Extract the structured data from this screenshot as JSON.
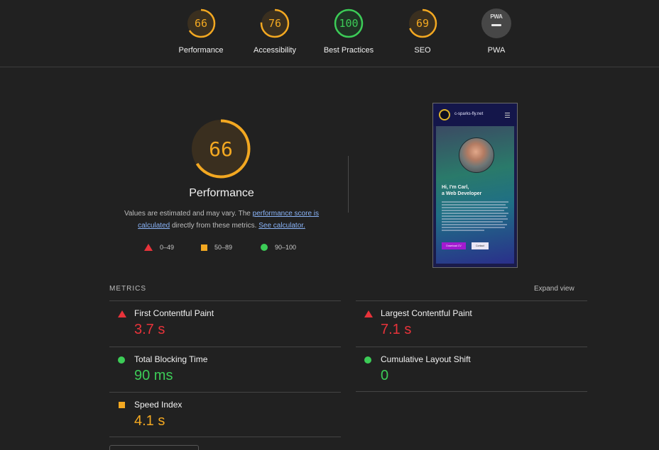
{
  "top_scores": [
    {
      "score": "66",
      "label": "Performance",
      "fraction": 0.66,
      "color": "#f3a821"
    },
    {
      "score": "76",
      "label": "Accessibility",
      "fraction": 0.76,
      "color": "#f3a821"
    },
    {
      "score": "100",
      "label": "Best Practices",
      "fraction": 1.0,
      "color": "#3ccc57"
    },
    {
      "score": "69",
      "label": "SEO",
      "fraction": 0.69,
      "color": "#f3a821"
    },
    {
      "score": "",
      "label": "PWA",
      "badge": "PWA"
    }
  ],
  "main": {
    "score": "66",
    "fraction": 0.66,
    "color": "#f3a821",
    "title": "Performance",
    "desc_1": "Values are estimated and may vary. The ",
    "link_score": "performance score is calculated",
    "desc_2": " directly from these metrics. ",
    "link_calc": "See calculator.",
    "legend": [
      {
        "range": "0–49",
        "symbol": "triangle",
        "color": "#e8333a"
      },
      {
        "range": "50–89",
        "symbol": "square",
        "color": "#f3a821"
      },
      {
        "range": "90–100",
        "symbol": "circle",
        "color": "#3ccc57"
      }
    ]
  },
  "preview": {
    "site_name": "c-sparks-fly.net",
    "heading_line1": "Hi, I'm Carl,",
    "heading_line2": "a Web Developer",
    "button_primary": "Download CV",
    "button_secondary": "Contact"
  },
  "metrics": {
    "heading": "METRICS",
    "expand_label": "Expand view",
    "items": [
      {
        "name": "First Contentful Paint",
        "value": "3.7 s",
        "status": "bad"
      },
      {
        "name": "Largest Contentful Paint",
        "value": "7.1 s",
        "status": "bad"
      },
      {
        "name": "Total Blocking Time",
        "value": "90 ms",
        "status": "good"
      },
      {
        "name": "Cumulative Layout Shift",
        "value": "0",
        "status": "good"
      },
      {
        "name": "Speed Index",
        "value": "4.1 s",
        "status": "avg"
      }
    ]
  },
  "colors": {
    "background": "#212121",
    "fail": "#e8333a",
    "average": "#f3a821",
    "pass": "#3ccc57",
    "link": "#8ab4f8"
  }
}
